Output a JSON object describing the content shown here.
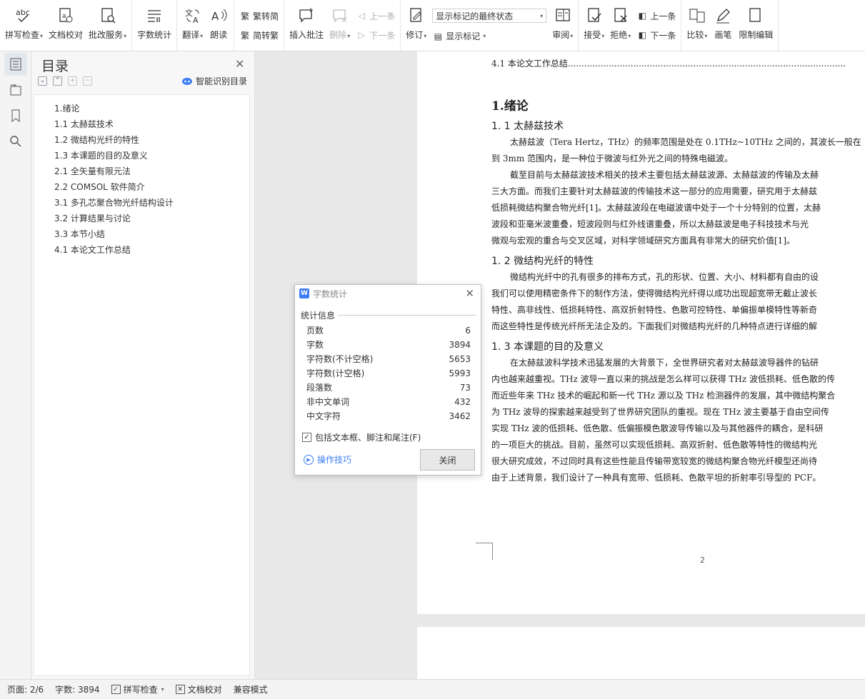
{
  "ribbon": {
    "spell_check": "拼写检查",
    "doc_proof": "文档校对",
    "markup_service": "批改服务",
    "word_count": "字数统计",
    "translate": "翻译",
    "read_aloud": "朗读",
    "to_traditional": "繁转简",
    "to_simplified": "简转繁",
    "insert_comment": "插入批注",
    "delete": "删除",
    "prev": "上一条",
    "next": "下一条",
    "track_changes": "修订",
    "markup_state": "显示标记的最终状态",
    "show_markup": "显示标记",
    "review": "审阅",
    "accept": "接受",
    "reject": "拒绝",
    "prev2": "上一条",
    "next2": "下一条",
    "compare": "比较",
    "pen": "画笔",
    "restrict": "限制编辑",
    "spell_icon_text": "abc"
  },
  "nav": {
    "title": "目录",
    "smart_toc": "智能识别目录",
    "items": [
      "1.绪论",
      "1.1  太赫兹技术",
      "1.2 微结构光纤的特性",
      "1.3  本课题的目的及意义",
      "2.1    全矢量有限元法",
      "2.2 COMSOL 软件简介",
      "3.1  多孔芯聚合物光纤结构设计",
      "3.2  计算结果与讨论",
      "3.3  本节小结",
      "4.1 本论文工作总结"
    ]
  },
  "doc": {
    "toc_line": "4.1 本论文工作总结......................................................................................................",
    "h_intro": "1.绪论",
    "h_1_1": "1. 1  太赫兹技术",
    "p1": [
      "太赫兹波（Tera Hertz，THz）的频率范围是处在 0.1THz~10THz 之间的，其波长一般在",
      "到 3mm 范围内，是一种位于微波与红外光之间的特殊电磁波。"
    ],
    "p2": [
      "截至目前与太赫兹波技术相关的技术主要包括太赫兹波源、太赫兹波的传输及太赫",
      "三大方面。而我们主要针对太赫兹波的传输技术这一部分的应用需要，研究用于太赫兹",
      "低损耗微结构聚合物光纤[1]。太赫兹波段在电磁波谱中处于一个十分特别的位置，太赫",
      "波段和亚毫米波重叠，短波段则与红外线谱重叠，所以太赫兹波是电子科技技术与光",
      "微观与宏观的重合与交叉区域，对科学领域研究方面具有非常大的研究价值[1]。"
    ],
    "h_1_2": "1. 2 微结构光纤的特性",
    "p3": [
      "微结构光纤中的孔有很多的排布方式，孔的形状、位置、大小、材料都有自由的设",
      "我们可以使用精密条件下的制作方法，使得微结构光纤得以成功出现超宽带无截止波长",
      "特性、高非线性、低损耗特性、高双折射特性、色散可控特性、单偏振单模特性等新奇",
      "而这些特性是传统光纤所无法企及的。下面我们对微结构光纤的几种特点进行详细的解"
    ],
    "h_1_3": "1. 3  本课题的目的及意义",
    "p4": [
      "在太赫兹波科学技术迅猛发展的大背景下，全世界研究者对太赫兹波导器件的钻研",
      "内也越来越重视。THz 波导一直以来的挑战是怎么样可以获得 THz 波低损耗、低色散的传",
      "而近些年来 THz 技术的崛起和新一代 THz 源以及 THz 检测器件的发展，其中微结构聚合",
      "为 THz 波导的探索越来越受到了世界研究团队的重视。现在 THz 波主要基于自由空间传",
      "实现 THz 波的低损耗、低色散、低偏振模色散波导传输以及与其他器件的耦合，是科研",
      "的一项巨大的挑战。目前，虽然可以实现低损耗、高双折射、低色散等特性的微结构光",
      "很大研究成效，不过同时具有这些性能且传输带宽较宽的微结构聚合物光纤模型还尚待",
      "由于上述背景，我们设计了一种具有宽带、低损耗、色散平坦的折射率引导型的 PCF。"
    ],
    "page_number": "2"
  },
  "dialog": {
    "title": "字数统计",
    "logo_text": "W",
    "section": "统计信息",
    "stats": [
      {
        "label": "页数",
        "value": "6"
      },
      {
        "label": "字数",
        "value": "3894"
      },
      {
        "label": "字符数(不计空格)",
        "value": "5653"
      },
      {
        "label": "字符数(计空格)",
        "value": "5993"
      },
      {
        "label": "段落数",
        "value": "73"
      },
      {
        "label": "非中文单词",
        "value": "432"
      },
      {
        "label": "中文字符",
        "value": "3462"
      }
    ],
    "include_label": "包括文本框、脚注和尾注(F)",
    "tips": "操作技巧",
    "close": "关闭"
  },
  "status": {
    "page": "页面: 2/6",
    "words": "字数: 3894",
    "spell": "拼写检查",
    "proof": "文档校对",
    "compat": "兼容模式"
  },
  "colors": {
    "accent": "#3d7df5"
  }
}
